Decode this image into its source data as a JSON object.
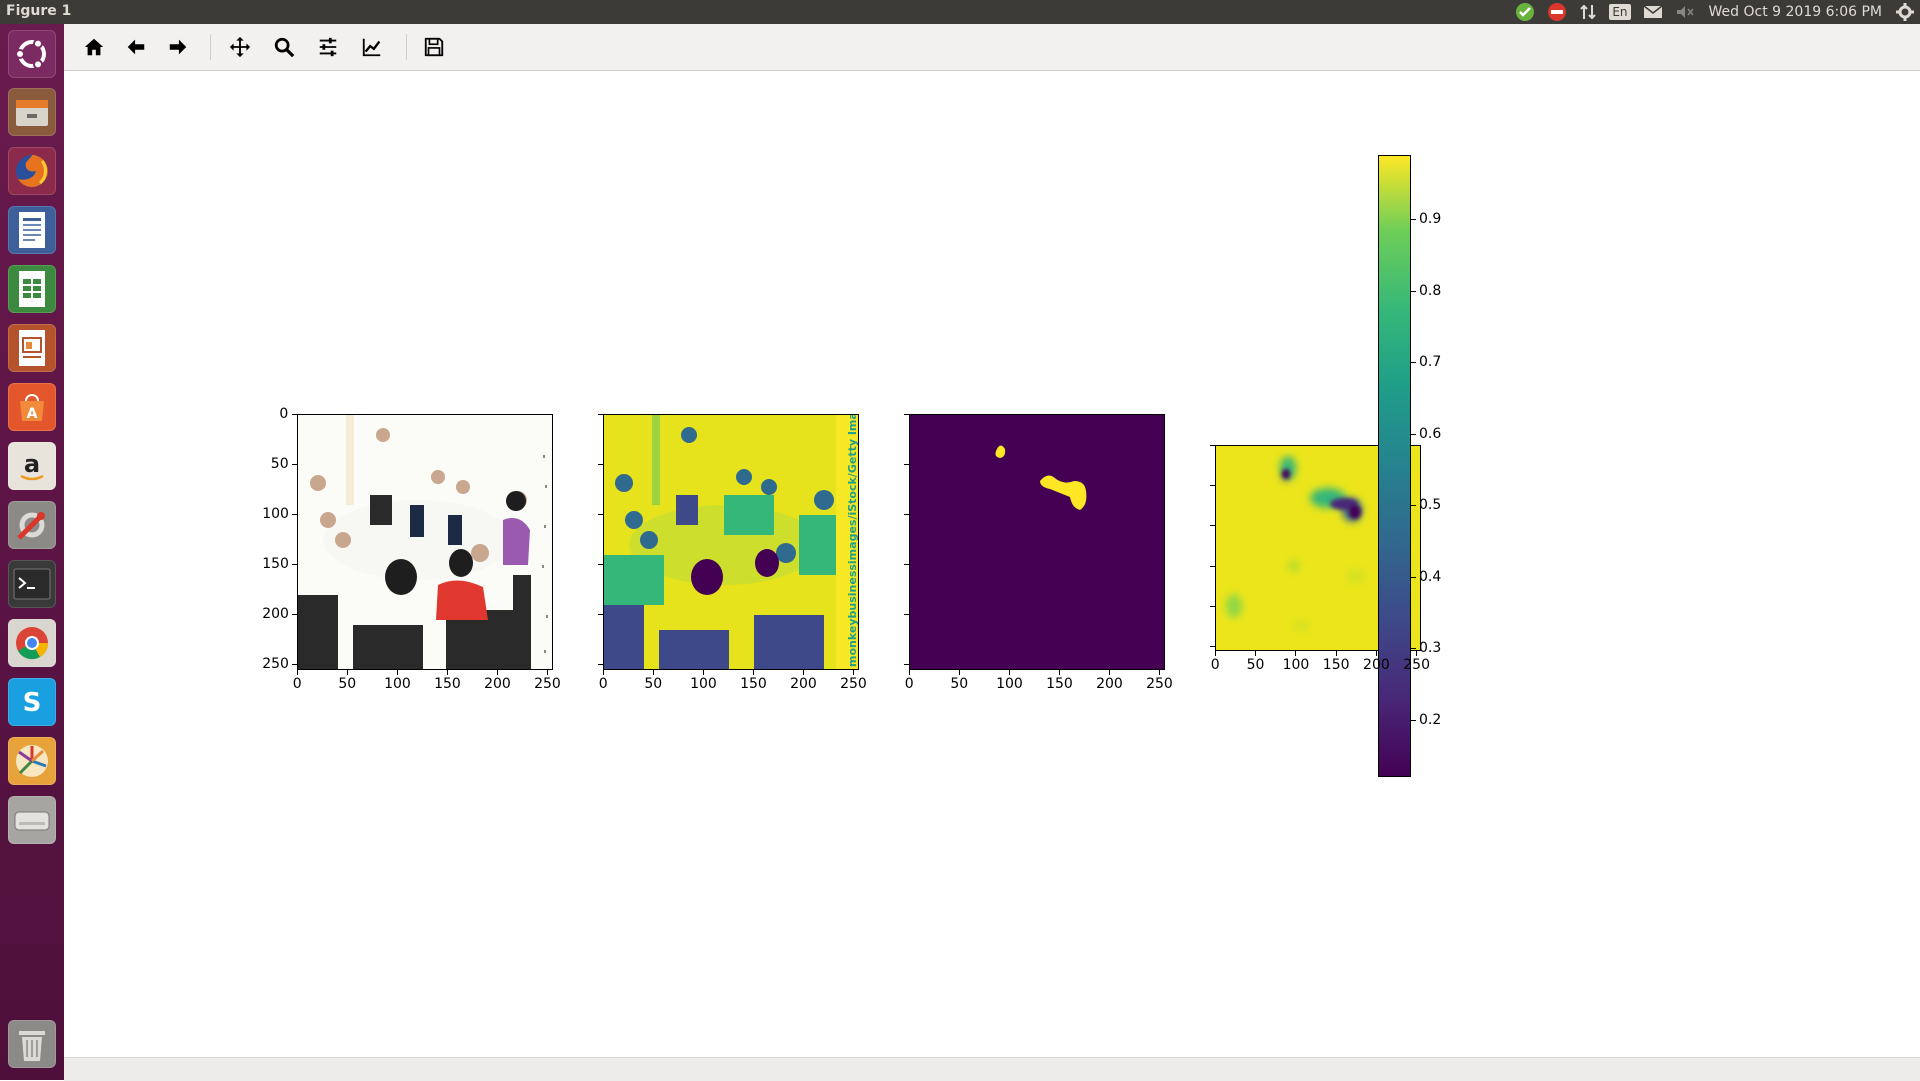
{
  "window": {
    "title": "Figure 1"
  },
  "tray": {
    "keyboard": "En",
    "datetime": "Wed Oct  9 2019  6:06 PM"
  },
  "launcher": {
    "items": [
      "ubuntu-dash-icon",
      "files-icon",
      "firefox-icon",
      "writer-icon",
      "calc-icon",
      "impress-icon",
      "software-center-icon",
      "amazon-icon",
      "system-settings-icon",
      "terminal-icon",
      "chrome-icon",
      "skype-icon",
      "pinwheel-app-icon",
      "disk-drive-icon",
      "trash-icon"
    ]
  },
  "toolbar": {
    "buttons": [
      "home-icon",
      "back-icon",
      "forward-icon",
      "pan-icon",
      "zoom-icon",
      "subplots-icon",
      "edit-axes-icon",
      "save-icon"
    ]
  },
  "figure": {
    "watermark": "monkeybusinessimages/iStock/Getty Images",
    "colorbar_ticks": [
      "0.9",
      "0.8",
      "0.7",
      "0.6",
      "0.5",
      "0.4",
      "0.3",
      "0.2"
    ]
  },
  "chart_data": [
    {
      "type": "heatmap",
      "content": "rgb image of people at a meeting table",
      "xticks": [
        0,
        50,
        100,
        150,
        200,
        250
      ],
      "yticks": [
        0,
        50,
        100,
        150,
        200,
        250
      ],
      "xlim": [
        0,
        256
      ],
      "ylim": [
        256,
        0
      ]
    },
    {
      "type": "heatmap",
      "content": "single-channel image, viridis colormap",
      "xticks": [
        0,
        50,
        100,
        150,
        200,
        250
      ],
      "xlim": [
        0,
        256
      ],
      "ylim": [
        256,
        0
      ]
    },
    {
      "type": "heatmap",
      "content": "binary mask, viridis colormap",
      "xticks": [
        0,
        50,
        100,
        150,
        200,
        250
      ],
      "xlim": [
        0,
        256
      ],
      "ylim": [
        256,
        0
      ]
    },
    {
      "type": "heatmap",
      "content": "probability map, viridis colormap",
      "xticks": [
        0,
        50,
        100,
        150,
        200,
        250
      ],
      "xlim": [
        0,
        256
      ],
      "ylim": [
        256,
        0
      ],
      "colorbar_range": [
        0.12,
        0.99
      ]
    }
  ]
}
